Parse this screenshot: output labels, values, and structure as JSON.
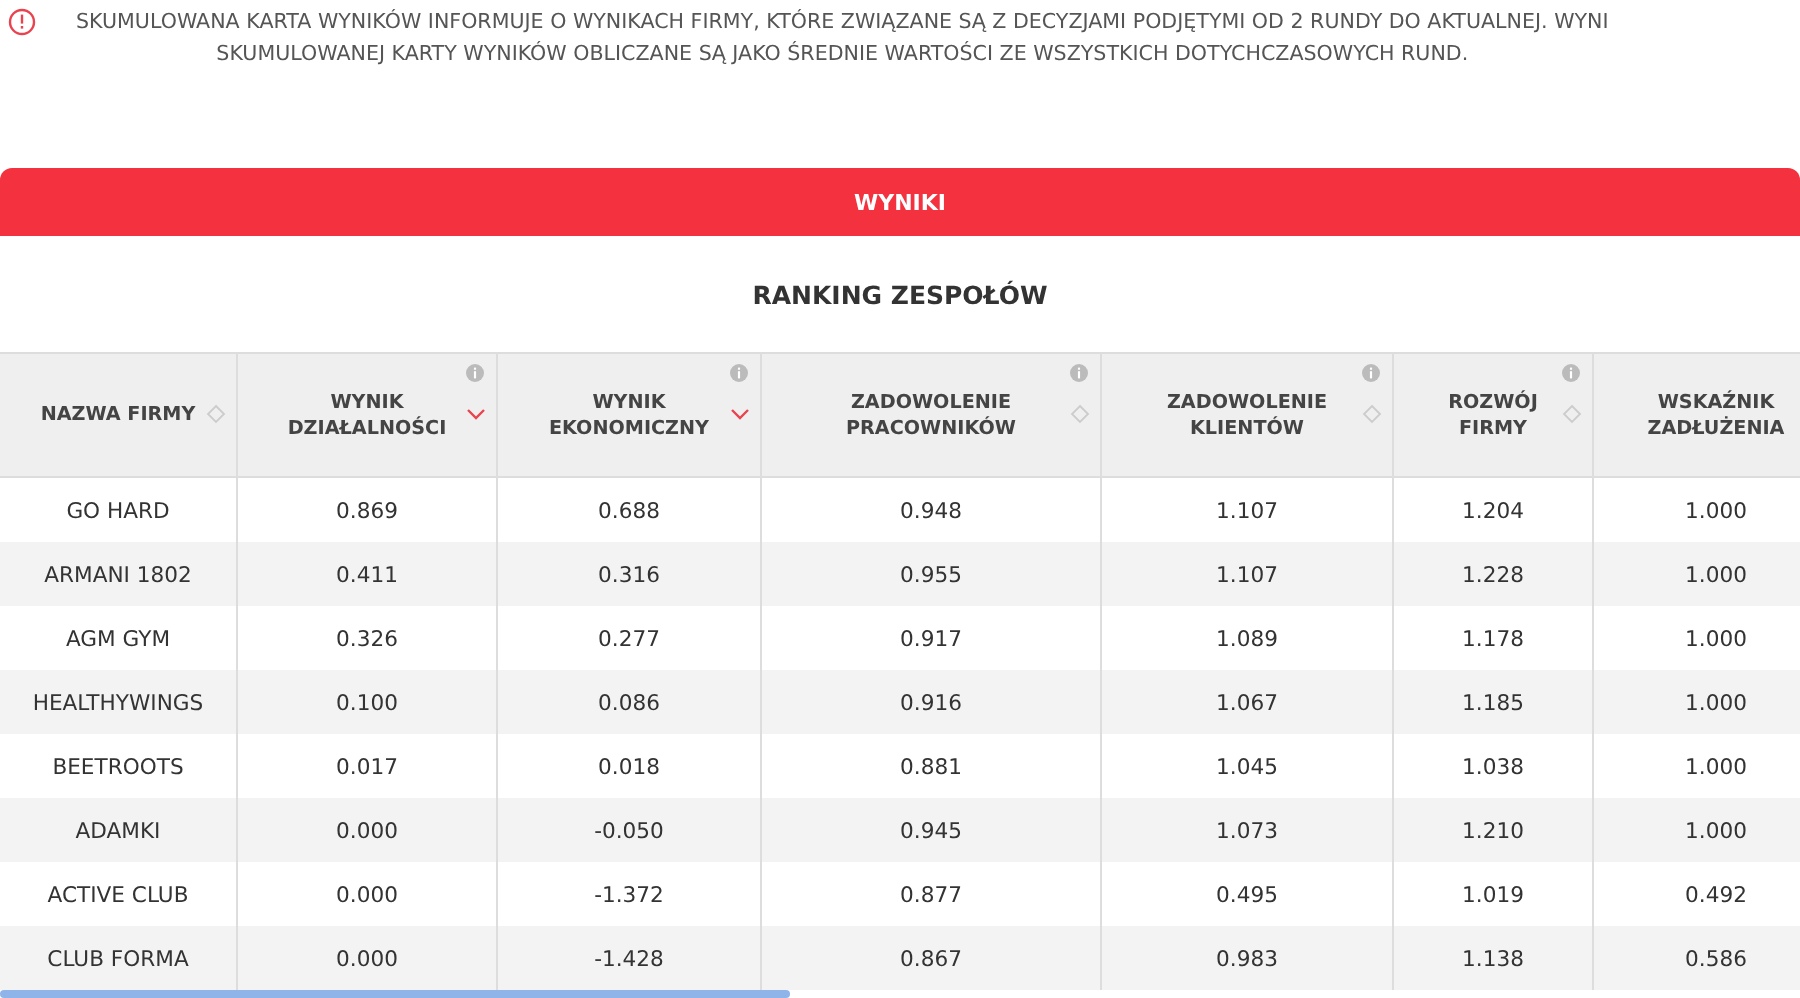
{
  "notice": {
    "lines": [
      "SKUMULOWANA KARTA WYNIKÓW INFORMUJE O WYNIKACH FIRMY, KTÓRE ZWIĄZANE SĄ Z DECYZJAMI PODJĘTYMI OD 2 RUNDY DO AKTUALNEJ. WYNI",
      "SKUMULOWANEJ KARTY WYNIKÓW OBLICZANE SĄ JAKO ŚREDNIE WARTOŚCI ZE WSZYSTKICH DOTYCHCZASOWYCH RUND."
    ]
  },
  "tab": {
    "label": "WYNIKI"
  },
  "table": {
    "title": "RANKING ZESPOŁÓW",
    "columns": [
      {
        "label": "NAZWA FIRMY",
        "sortable": true,
        "sorted": false,
        "info": false
      },
      {
        "label": "WYNIK DZIAŁALNOŚCI",
        "sortable": true,
        "sorted": true,
        "info": true
      },
      {
        "label": "WYNIK EKONOMICZNY",
        "sortable": true,
        "sorted": true,
        "info": true
      },
      {
        "label": "ZADOWOLENIE PRACOWNIKÓW",
        "sortable": true,
        "sorted": false,
        "info": true
      },
      {
        "label": "ZADOWOLENIE KLIENTÓW",
        "sortable": true,
        "sorted": false,
        "info": true
      },
      {
        "label": "ROZWÓJ FIRMY",
        "sortable": true,
        "sorted": false,
        "info": true
      },
      {
        "label": "WSKAŹNIK ZADŁUŻENIA",
        "sortable": false,
        "info": false
      }
    ],
    "rows": [
      [
        "GO HARD",
        "0.869",
        "0.688",
        "0.948",
        "1.107",
        "1.204",
        "1.000"
      ],
      [
        "ARMANI 1802",
        "0.411",
        "0.316",
        "0.955",
        "1.107",
        "1.228",
        "1.000"
      ],
      [
        "AGM GYM",
        "0.326",
        "0.277",
        "0.917",
        "1.089",
        "1.178",
        "1.000"
      ],
      [
        "HEALTHYWINGS",
        "0.100",
        "0.086",
        "0.916",
        "1.067",
        "1.185",
        "1.000"
      ],
      [
        "BEETROOTS",
        "0.017",
        "0.018",
        "0.881",
        "1.045",
        "1.038",
        "1.000"
      ],
      [
        "ADAMKI",
        "0.000",
        "-0.050",
        "0.945",
        "1.073",
        "1.210",
        "1.000"
      ],
      [
        "ACTIVE CLUB",
        "0.000",
        "-1.372",
        "0.877",
        "0.495",
        "1.019",
        "0.492"
      ],
      [
        "CLUB FORMA",
        "0.000",
        "-1.428",
        "0.867",
        "0.983",
        "1.138",
        "0.586"
      ]
    ]
  }
}
